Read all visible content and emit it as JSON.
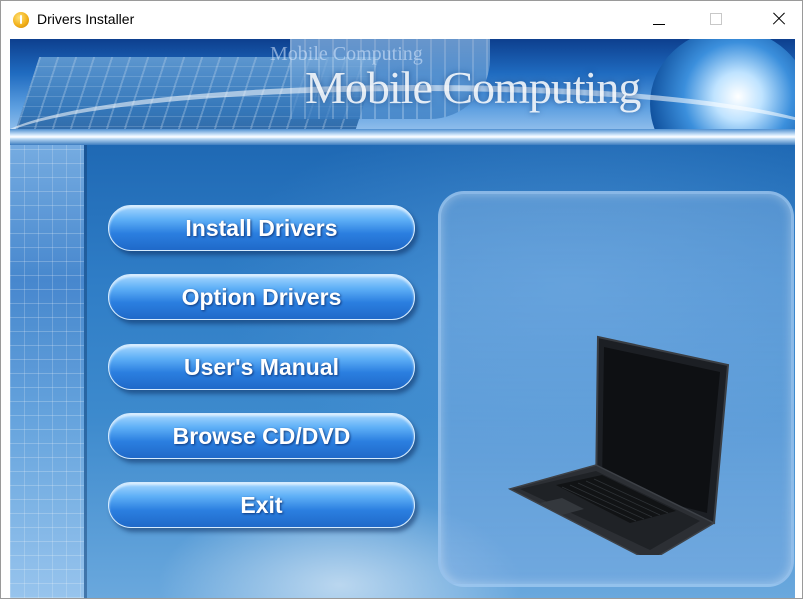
{
  "window": {
    "title": "Drivers Installer"
  },
  "banner": {
    "small_text": "Mobile Computing",
    "big_text": "Mobile Computing"
  },
  "menu": {
    "install_drivers": "Install Drivers",
    "option_drivers": "Option Drivers",
    "users_manual": "User's Manual",
    "browse_cd_dvd": "Browse CD/DVD",
    "exit": "Exit"
  },
  "icons": {
    "app": "app-icon",
    "minimize": "minimize-icon",
    "maximize": "maximize-icon",
    "close": "close-icon"
  },
  "colors": {
    "button_top": "#a7d7ff",
    "button_bottom": "#1f69c9",
    "background": "#2f7dc6"
  }
}
